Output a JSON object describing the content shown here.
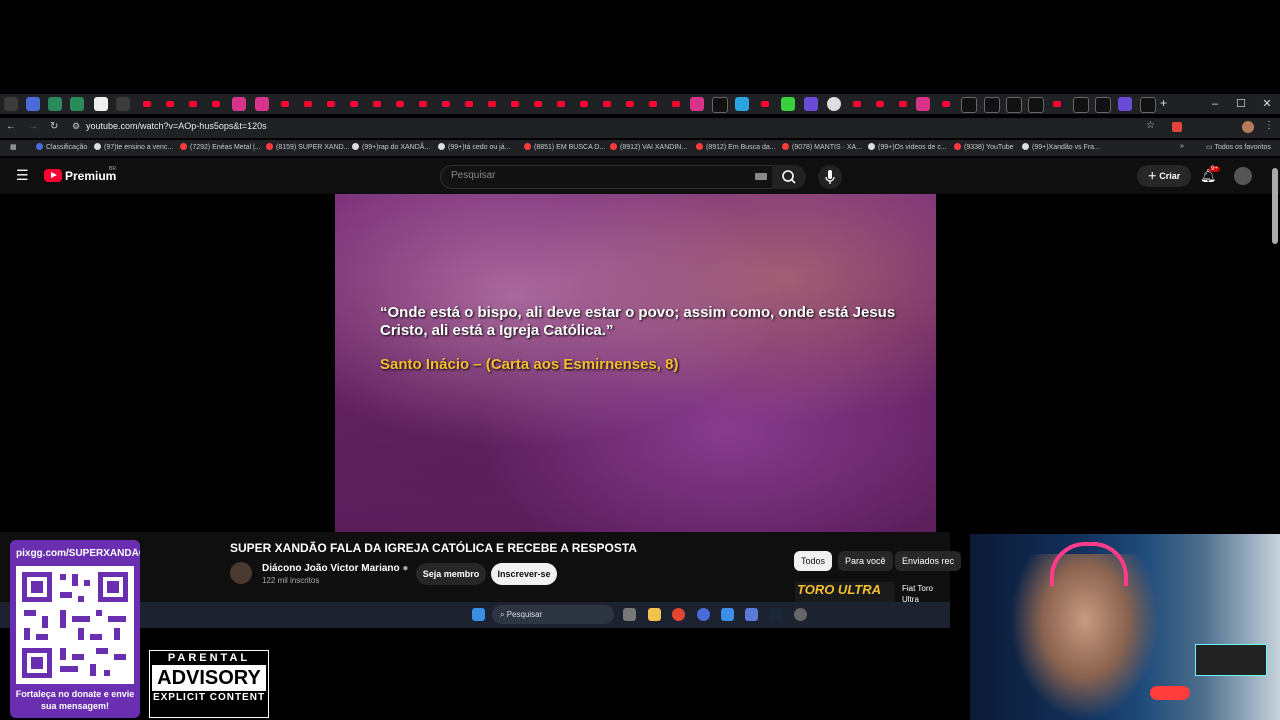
{
  "browser": {
    "url": "youtube.com/watch?v=AOp-hus5ops&t=120s",
    "window_controls": [
      "–",
      "☐",
      "✕"
    ],
    "bookmarks": [
      "Classificação",
      "(97)te ensino a venc...",
      "(7292) Enéas Metal |...",
      "(8159) SUPER XAND...",
      "(99+)rap do XANDÃ...",
      "(99+)tá cedo ou já...",
      "(8851) EM BUSCA D...",
      "(8912) VAI XANDIN...",
      "(8912) Em Busca da...",
      "(9078) MANTIS · XA...",
      "(99+)Os videos de c...",
      "(9338) YouTube",
      "(99+)Xandão vs Fra..."
    ],
    "bookmarks_all": "Todos os favoritos"
  },
  "youtube": {
    "brand": "Premium",
    "region": "BR",
    "search_placeholder": "Pesquisar",
    "create_label": "Criar",
    "notification_count": "9+"
  },
  "video": {
    "quote": "“Onde está o bispo, ali deve estar o povo; assim como, onde está Jesus Cristo, ali está a Igreja Católica.”",
    "citation": "Santo Inácio – (Carta aos Esmirnenses, 8)",
    "title": "SUPER XANDÃO FALA DA IGREJA CATÓLICA E RECEBE A RESPOSTA",
    "channel": "Diácono João Victor Mariano",
    "subscribers": "122 mil inscritos",
    "member_label": "Seja membro",
    "subscribe_label": "Inscrever-se"
  },
  "sidebar": {
    "chips": [
      "Todos",
      "Para você",
      "Enviados rec"
    ],
    "thumb_text": "TORO ULTRA",
    "item_title": "Fiat Toro Ultra RAMPAGE o"
  },
  "taskbar": {
    "search_placeholder": "Pesquisar"
  },
  "overlay": {
    "donate_url": "pixgg.com/SUPERXANDÃO",
    "donate_message": "Fortaleça no donate e envie sua mensagem!",
    "advisory_line1": "PARENTAL",
    "advisory_line2": "ADVISORY",
    "advisory_line3": "EXPLICIT CONTENT"
  },
  "colors": {
    "youtube_red": "#ff0033",
    "citation_gold": "#f3bf2f",
    "donate_purple": "#6a2fb0"
  }
}
